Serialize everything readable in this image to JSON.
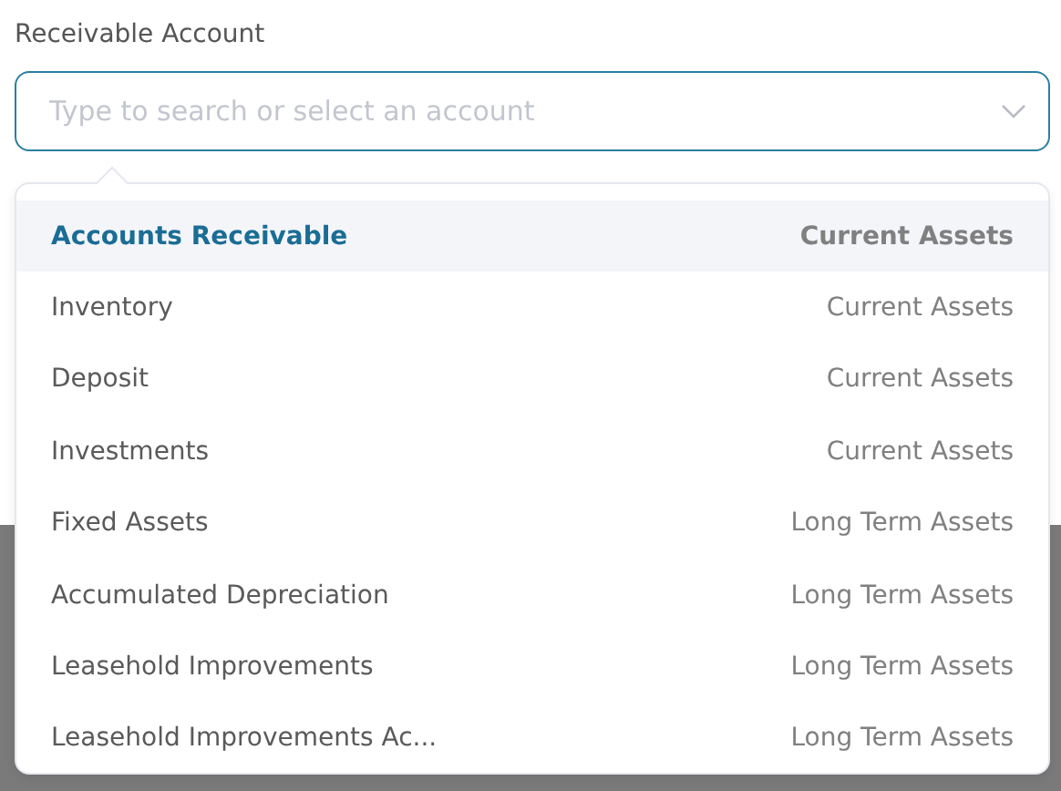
{
  "field": {
    "label": "Receivable Account",
    "placeholder": "Type to search or select an account"
  },
  "options": [
    {
      "name": "Accounts Receivable",
      "type": "Current Assets",
      "selected": true
    },
    {
      "name": "Inventory",
      "type": "Current Assets",
      "selected": false
    },
    {
      "name": "Deposit",
      "type": "Current Assets",
      "selected": false
    },
    {
      "name": "Investments",
      "type": "Current Assets",
      "selected": false
    },
    {
      "name": "Fixed Assets",
      "type": "Long Term Assets",
      "selected": false
    },
    {
      "name": "Accumulated Depreciation",
      "type": "Long Term Assets",
      "selected": false
    },
    {
      "name": "Leasehold Improvements",
      "type": "Long Term Assets",
      "selected": false
    },
    {
      "name": "Leasehold Improvements Ac...",
      "type": "Long Term Assets",
      "selected": false
    }
  ]
}
